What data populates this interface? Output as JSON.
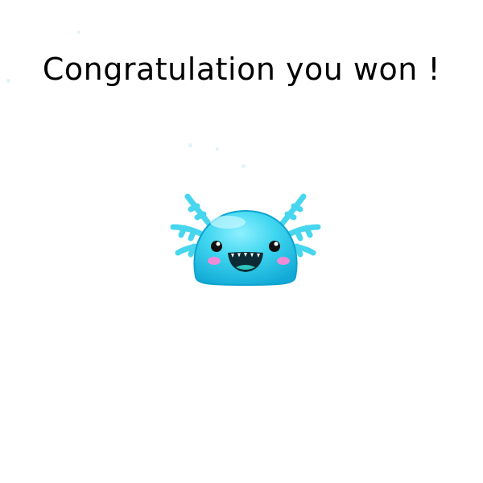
{
  "message": {
    "text": "Congratulation you won !"
  },
  "mascot": {
    "icon": "axolotl-mascot-icon",
    "body_color": "#2fd0ec",
    "gill_color": "#4ad7ef",
    "cheek_color": "#f08bd8"
  }
}
